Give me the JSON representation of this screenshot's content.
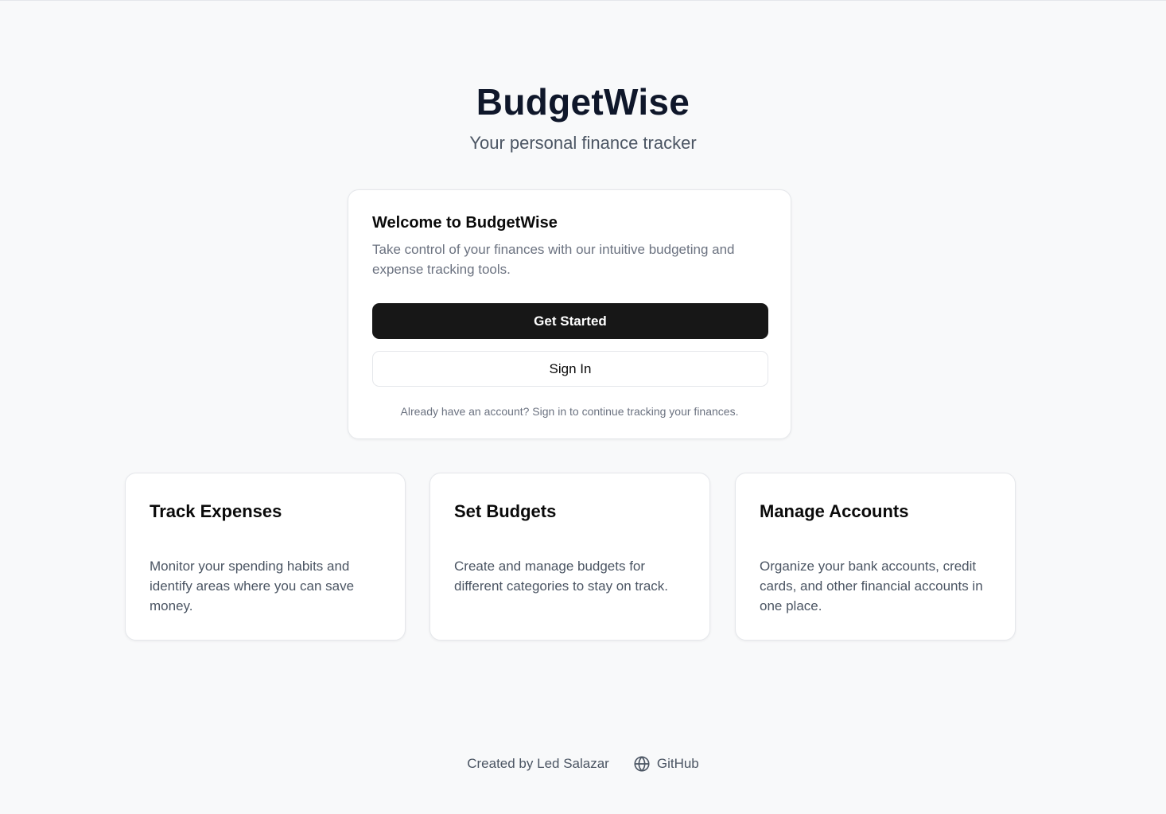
{
  "app": {
    "title": "BudgetWise",
    "tagline": "Your personal finance tracker"
  },
  "welcome": {
    "heading": "Welcome to BudgetWise",
    "description": "Take control of your finances with our intuitive budgeting and expense tracking tools.",
    "primary_button": "Get Started",
    "secondary_button": "Sign In",
    "note": "Already have an account? Sign in to continue tracking your finances."
  },
  "features": [
    {
      "title": "Track Expenses",
      "description": "Monitor your spending habits and identify areas where you can save money."
    },
    {
      "title": "Set Budgets",
      "description": "Create and manage budgets for different categories to stay on track."
    },
    {
      "title": "Manage Accounts",
      "description": "Organize your bank accounts, credit cards, and other financial accounts in one place."
    }
  ],
  "footer": {
    "credit": "Created by Led Salazar",
    "link_label": "GitHub",
    "link_icon": "globe-icon"
  },
  "colors": {
    "background": "#f8f9fa",
    "primary_button": "#171717",
    "card_border": "#e5e7eb",
    "muted_text": "#6b7280"
  }
}
